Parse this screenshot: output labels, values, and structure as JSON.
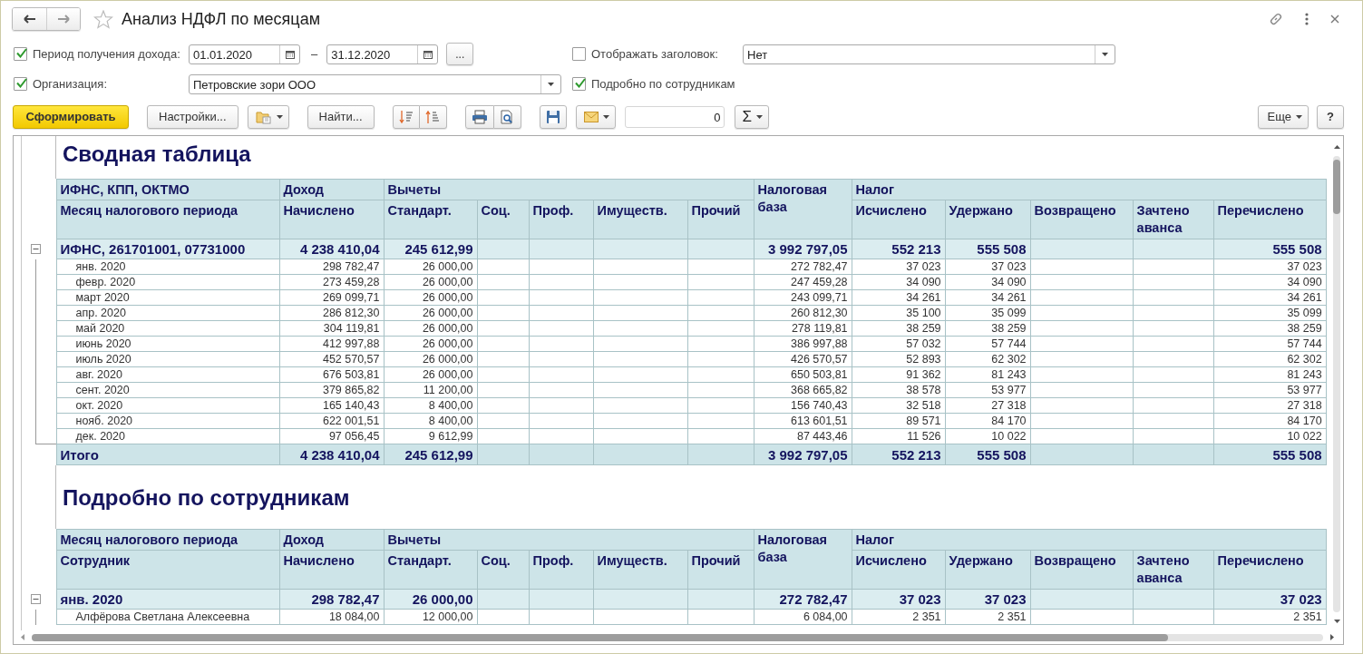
{
  "window": {
    "title": "Анализ НДФЛ по месяцам",
    "favorite": false
  },
  "filters": {
    "period": {
      "label": "Период получения дохода:",
      "checked": true,
      "from": "01.01.2020",
      "separator": "–",
      "to": "31.12.2020",
      "more": "..."
    },
    "show_header": {
      "label": "Отображать заголовок:",
      "checked": false,
      "value": "Нет"
    },
    "organization": {
      "label": "Организация:",
      "checked": true,
      "value": "Петровские зори ООО"
    },
    "by_employee": {
      "label": "Подробно по сотрудникам",
      "checked": true
    }
  },
  "toolbar": {
    "generate": "Сформировать",
    "settings": "Настройки...",
    "find": "Найти...",
    "amount": "0",
    "sum": "Σ",
    "more": "Еще",
    "help": "?"
  },
  "report": {
    "sections": [
      {
        "title": "Сводная таблица",
        "header_top": [
          "ИФНС, КПП, ОКТМО",
          "Доход",
          "Вычеты",
          "Налоговая база",
          "Налог"
        ],
        "header_sub": [
          "Месяц налогового периода",
          "Начислено",
          "Стандарт.",
          "Соц.",
          "Проф.",
          "Имуществ.",
          "Прочий",
          "Исчислено",
          "Удержано",
          "Возвращено",
          "Зачтено аванса",
          "Перечислено"
        ],
        "rows": [
          {
            "kind": "group",
            "expanded": true,
            "cells": [
              "ИФНС, 261701001, 07731000",
              "4 238 410,04",
              "245 612,99",
              null,
              null,
              null,
              null,
              "3 992 797,05",
              "552 213",
              "555 508",
              null,
              null,
              "555 508"
            ],
            "children": [
              {
                "cells": [
                  "янв. 2020",
                  "298 782,47",
                  "26 000,00",
                  null,
                  null,
                  null,
                  null,
                  "272 782,47",
                  "37 023",
                  "37 023",
                  null,
                  null,
                  "37 023"
                ]
              },
              {
                "cells": [
                  "февр. 2020",
                  "273 459,28",
                  "26 000,00",
                  null,
                  null,
                  null,
                  null,
                  "247 459,28",
                  "34 090",
                  "34 090",
                  null,
                  null,
                  "34 090"
                ]
              },
              {
                "cells": [
                  "март 2020",
                  "269 099,71",
                  "26 000,00",
                  null,
                  null,
                  null,
                  null,
                  "243 099,71",
                  "34 261",
                  "34 261",
                  null,
                  null,
                  "34 261"
                ]
              },
              {
                "cells": [
                  "апр. 2020",
                  "286 812,30",
                  "26 000,00",
                  null,
                  null,
                  null,
                  null,
                  "260 812,30",
                  "35 100",
                  "35 099",
                  null,
                  null,
                  "35 099"
                ]
              },
              {
                "cells": [
                  "май 2020",
                  "304 119,81",
                  "26 000,00",
                  null,
                  null,
                  null,
                  null,
                  "278 119,81",
                  "38 259",
                  "38 259",
                  null,
                  null,
                  "38 259"
                ]
              },
              {
                "cells": [
                  "июнь 2020",
                  "412 997,88",
                  "26 000,00",
                  null,
                  null,
                  null,
                  null,
                  "386 997,88",
                  "57 032",
                  "57 744",
                  null,
                  null,
                  "57 744"
                ]
              },
              {
                "cells": [
                  "июль 2020",
                  "452 570,57",
                  "26 000,00",
                  null,
                  null,
                  null,
                  null,
                  "426 570,57",
                  "52 893",
                  "62 302",
                  null,
                  null,
                  "62 302"
                ]
              },
              {
                "cells": [
                  "авг. 2020",
                  "676 503,81",
                  "26 000,00",
                  null,
                  null,
                  null,
                  null,
                  "650 503,81",
                  "91 362",
                  "81 243",
                  null,
                  null,
                  "81 243"
                ]
              },
              {
                "cells": [
                  "сент. 2020",
                  "379 865,82",
                  "11 200,00",
                  null,
                  null,
                  null,
                  null,
                  "368 665,82",
                  "38 578",
                  "53 977",
                  null,
                  null,
                  "53 977"
                ]
              },
              {
                "cells": [
                  "окт. 2020",
                  "165 140,43",
                  "8 400,00",
                  null,
                  null,
                  null,
                  null,
                  "156 740,43",
                  "32 518",
                  "27 318",
                  null,
                  null,
                  "27 318"
                ]
              },
              {
                "cells": [
                  "нояб. 2020",
                  "622 001,51",
                  "8 400,00",
                  null,
                  null,
                  null,
                  null,
                  "613 601,51",
                  "89 571",
                  "84 170",
                  null,
                  null,
                  "84 170"
                ]
              },
              {
                "cells": [
                  "дек. 2020",
                  "97 056,45",
                  "9 612,99",
                  null,
                  null,
                  null,
                  null,
                  "87 443,46",
                  "11 526",
                  "10 022",
                  null,
                  null,
                  "10 022"
                ]
              }
            ]
          },
          {
            "kind": "total",
            "cells": [
              "Итого",
              "4 238 410,04",
              "245 612,99",
              null,
              null,
              null,
              null,
              "3 992 797,05",
              "552 213",
              "555 508",
              null,
              null,
              "555 508"
            ]
          }
        ]
      },
      {
        "title": "Подробно по сотрудникам",
        "header_top": [
          "Месяц налогового периода",
          "Доход",
          "Вычеты",
          "Налоговая база",
          "Налог"
        ],
        "header_sub": [
          "Сотрудник",
          "Начислено",
          "Стандарт.",
          "Соц.",
          "Проф.",
          "Имуществ.",
          "Прочий",
          "Исчислено",
          "Удержано",
          "Возвращено",
          "Зачтено аванса",
          "Перечислено"
        ],
        "rows": [
          {
            "kind": "group",
            "expanded": true,
            "cells": [
              "янв. 2020",
              "298 782,47",
              "26 000,00",
              null,
              null,
              null,
              null,
              "272 782,47",
              "37 023",
              "37 023",
              null,
              null,
              "37 023"
            ],
            "children": [
              {
                "cells": [
                  "Алфёрова Светлана Алексеевна",
                  "18 084,00",
                  "12 000,00",
                  null,
                  null,
                  null,
                  null,
                  "6 084,00",
                  "2 351",
                  "2 351",
                  null,
                  null,
                  "2 351"
                ]
              }
            ]
          }
        ]
      }
    ]
  }
}
